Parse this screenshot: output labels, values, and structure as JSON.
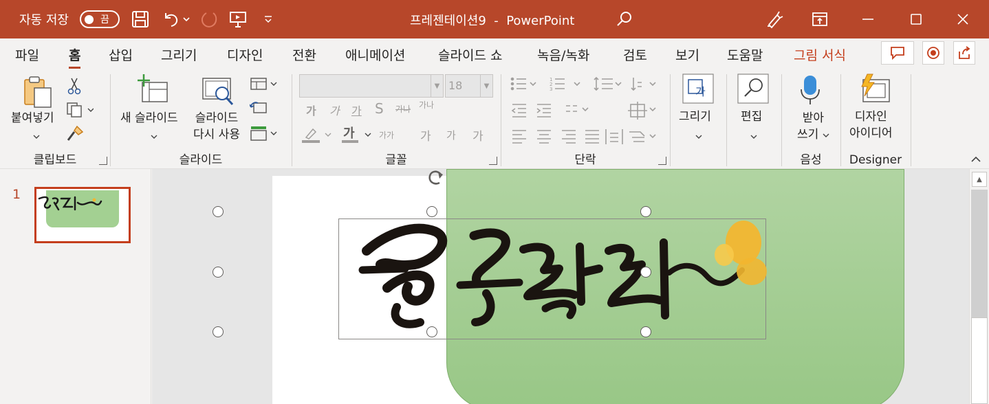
{
  "titlebar": {
    "autosave_label": "자동 저장",
    "autosave_state": "끔",
    "document_name": "프레젠테이션9  -  PowerPoint",
    "bg_color": "#b7472a"
  },
  "tabs": [
    {
      "label": "파일"
    },
    {
      "label": "홈"
    },
    {
      "label": "삽입"
    },
    {
      "label": "그리기"
    },
    {
      "label": "디자인"
    },
    {
      "label": "전환"
    },
    {
      "label": "애니메이션"
    },
    {
      "label": "슬라이드 쇼"
    },
    {
      "label": "녹음/녹화"
    },
    {
      "label": "검토"
    },
    {
      "label": "보기"
    },
    {
      "label": "도움말"
    },
    {
      "label": "그림 서식"
    }
  ],
  "ribbon": {
    "clipboard": {
      "paste_label": "붙여넣기",
      "group_label": "클립보드"
    },
    "slides": {
      "new_slide_label": "새 슬라이드",
      "reuse_label_1": "슬라이드",
      "reuse_label_2": "다시 사용",
      "group_label": "슬라이드"
    },
    "font": {
      "font_size": "18",
      "group_label": "글꼴",
      "bold_glyph": "가",
      "italic_glyph": "가",
      "underline_glyph": "가",
      "shadow_glyph": "S",
      "strike_glyph": "가나",
      "spacing_glyph": "가나",
      "case_glyph": "가가",
      "grow_glyph": "가",
      "shrink_glyph": "가",
      "clear_glyph": "가"
    },
    "paragraph": {
      "group_label": "단락"
    },
    "drawing": {
      "label": "그리기"
    },
    "editing": {
      "label": "편집"
    },
    "voice": {
      "dictate_label_1": "받아",
      "dictate_label_2": "쓰기",
      "group_label": "음성"
    },
    "designer": {
      "label_1": "디자인",
      "label_2": "아이디어",
      "group_label": "Designer"
    }
  },
  "thumbnails": [
    {
      "number": "1"
    }
  ],
  "colors": {
    "accent": "#b7472a",
    "slide_shape": "#a3d092",
    "logo_yellow": "#f2b630"
  },
  "icons": {
    "save": "save-icon",
    "undo": "undo-icon",
    "redo": "redo-icon",
    "present": "present-from-start-icon",
    "customize": "customize-qat-icon",
    "search": "search-icon",
    "pen": "pen-icon",
    "ribbon_display": "ribbon-display-options-icon",
    "minimize": "minimize-icon",
    "maximize": "maximize-icon",
    "close": "close-icon",
    "comments": "comments-icon",
    "record": "record-icon",
    "share": "share-icon"
  }
}
